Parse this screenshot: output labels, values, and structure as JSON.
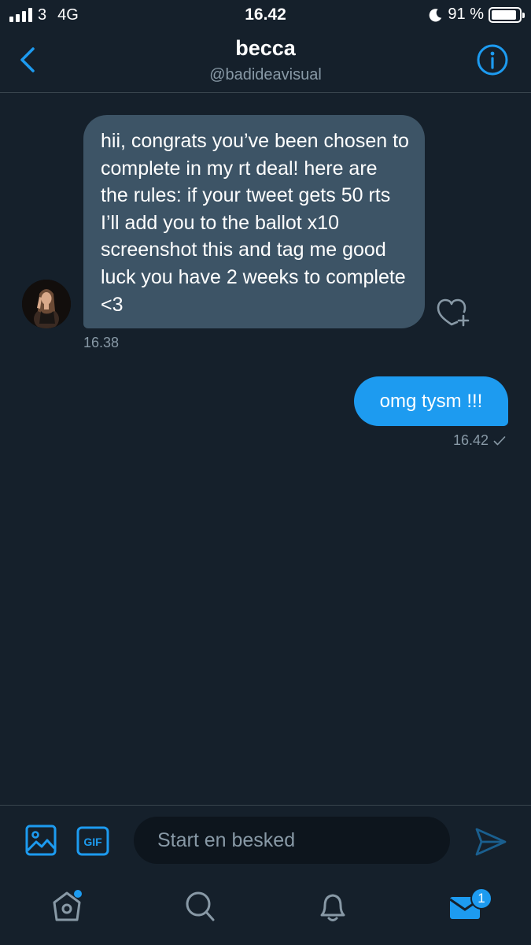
{
  "status_bar": {
    "carrier": "3",
    "network": "4G",
    "time": "16.42",
    "battery": "91 %",
    "battery_level": 0.91
  },
  "header": {
    "name": "becca",
    "handle": "@badideavisual"
  },
  "messages": [
    {
      "direction": "incoming",
      "text": "hii, congrats you’ve been chosen to complete in my rt deal! here are the rules: if your tweet gets 50 rts I’ll add you to the ballot x10 screenshot this and tag me good luck you have 2 weeks to complete <3",
      "time": "16.38"
    },
    {
      "direction": "outgoing",
      "text": "omg tysm !!!",
      "time": "16.42",
      "status_icon": "check-icon"
    }
  ],
  "composer": {
    "placeholder": "Start en besked",
    "gif_label": "GIF"
  },
  "tabbar": {
    "tabs": [
      "home-icon",
      "search-icon",
      "notifications-icon",
      "messages-icon"
    ],
    "messages_badge": "1"
  },
  "colors": {
    "background": "#15202b",
    "accent": "#1d9bf0",
    "incoming_bubble": "#3d5466",
    "secondary_text": "#8899a6"
  }
}
